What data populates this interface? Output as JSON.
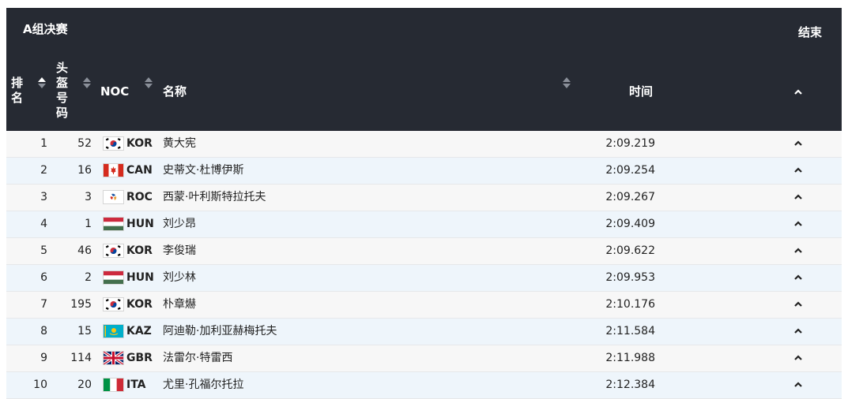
{
  "header": {
    "title": "A组决赛",
    "status": "结束",
    "col_rank": "排名",
    "col_bib": "头盔号码",
    "col_noc": "NOC",
    "col_name": "名称",
    "col_time": "时间"
  },
  "rows": [
    {
      "rank": "1",
      "bib": "52",
      "noc": "KOR",
      "name": "黄大宪",
      "time": "2:09.219"
    },
    {
      "rank": "2",
      "bib": "16",
      "noc": "CAN",
      "name": "史蒂文·杜博伊斯",
      "time": "2:09.254"
    },
    {
      "rank": "3",
      "bib": "3",
      "noc": "ROC",
      "name": "西蒙·叶利斯特拉托夫",
      "time": "2:09.267"
    },
    {
      "rank": "4",
      "bib": "1",
      "noc": "HUN",
      "name": "刘少昂",
      "time": "2:09.409"
    },
    {
      "rank": "5",
      "bib": "46",
      "noc": "KOR",
      "name": "李俊瑞",
      "time": "2:09.622"
    },
    {
      "rank": "6",
      "bib": "2",
      "noc": "HUN",
      "name": "刘少林",
      "time": "2:09.953"
    },
    {
      "rank": "7",
      "bib": "195",
      "noc": "KOR",
      "name": "朴章爀",
      "time": "2:10.176"
    },
    {
      "rank": "8",
      "bib": "15",
      "noc": "KAZ",
      "name": "阿迪勒·加利亚赫梅托夫",
      "time": "2:11.584"
    },
    {
      "rank": "9",
      "bib": "114",
      "noc": "GBR",
      "name": "法雷尔·特雷西",
      "time": "2:11.988"
    },
    {
      "rank": "10",
      "bib": "20",
      "noc": "ITA",
      "name": "尤里·孔福尔托拉",
      "time": "2:12.384"
    }
  ],
  "colors": {
    "header_bg": "#262a33",
    "row_odd": "#f7f7f7",
    "row_even": "#eef5fb"
  }
}
